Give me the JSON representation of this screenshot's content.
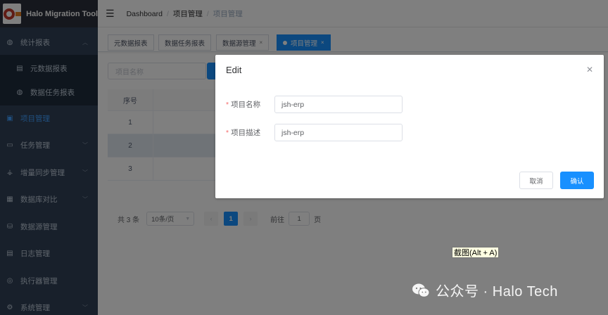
{
  "app": {
    "title": "Halo Migration Tool"
  },
  "sidebar": {
    "items": [
      {
        "label": "统计报表",
        "icon": "dashboard-icon",
        "expandable": true
      },
      {
        "label": "元数据报表",
        "icon": "report-icon"
      },
      {
        "label": "数据任务报表",
        "icon": "dashboard-icon"
      },
      {
        "label": "项目管理",
        "icon": "project-icon",
        "active": true
      },
      {
        "label": "任务管理",
        "icon": "monitor-icon",
        "expandable": true
      },
      {
        "label": "增量同步管理",
        "icon": "tree-icon",
        "expandable": true
      },
      {
        "label": "数据库对比",
        "icon": "document-icon",
        "expandable": true
      },
      {
        "label": "数据源管理",
        "icon": "database-icon"
      },
      {
        "label": "日志管理",
        "icon": "log-icon"
      },
      {
        "label": "执行器管理",
        "icon": "eye-icon"
      },
      {
        "label": "系统管理",
        "icon": "settings-icon",
        "expandable": true
      }
    ]
  },
  "navbar": {
    "breadcrumb": [
      "Dashboard",
      "项目管理",
      "项目管理"
    ]
  },
  "tags": [
    {
      "label": "元数据报表"
    },
    {
      "label": "数据任务报表"
    },
    {
      "label": "数据源管理"
    },
    {
      "label": "项目管理",
      "active": true
    }
  ],
  "search": {
    "placeholder": "项目名称"
  },
  "table": {
    "index_header": "序号",
    "rows": [
      "1",
      "2",
      "3"
    ]
  },
  "pagination": {
    "total": "共 3 条",
    "page_size": "10条/页",
    "current": "1",
    "goto_prefix": "前往",
    "goto_value": "1",
    "goto_suffix": "页"
  },
  "dialog": {
    "title": "Edit",
    "fields": [
      {
        "label": "项目名称",
        "value": "jsh-erp"
      },
      {
        "label": "项目描述",
        "value": "jsh-erp"
      }
    ],
    "cancel": "取消",
    "confirm": "确认"
  },
  "screenshot_tip": "截图(Alt + A)",
  "watermark": "公众号 · Halo Tech",
  "colors": {
    "primary": "#1890ff",
    "sidebar_bg": "#304156",
    "active_menu": "#409eff"
  }
}
